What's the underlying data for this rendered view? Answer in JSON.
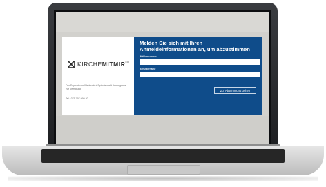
{
  "logo": {
    "text_normal": "KIRCHE",
    "text_bold": "MITMIR",
    "tm": "CH",
    "icon": "cross-x-logo-icon"
  },
  "left_panel": {
    "info": "Der Support von Webbook + Spindle steht Ihnen gerne zur Verfügung",
    "phone": "Tel +371 797 999 20"
  },
  "login": {
    "title": "Melden Sie sich mit Ihren Anmeldeinformationen an, um abzustimmen",
    "field1_label": "Wählernummer",
    "field1_value": "",
    "field2_label": "Benutzername",
    "field2_value": "",
    "submit_label": "Zur Abstimmung gehen"
  },
  "colors": {
    "panel_blue": "#0f4c8a",
    "screen_bg": "#d2d1cd"
  }
}
